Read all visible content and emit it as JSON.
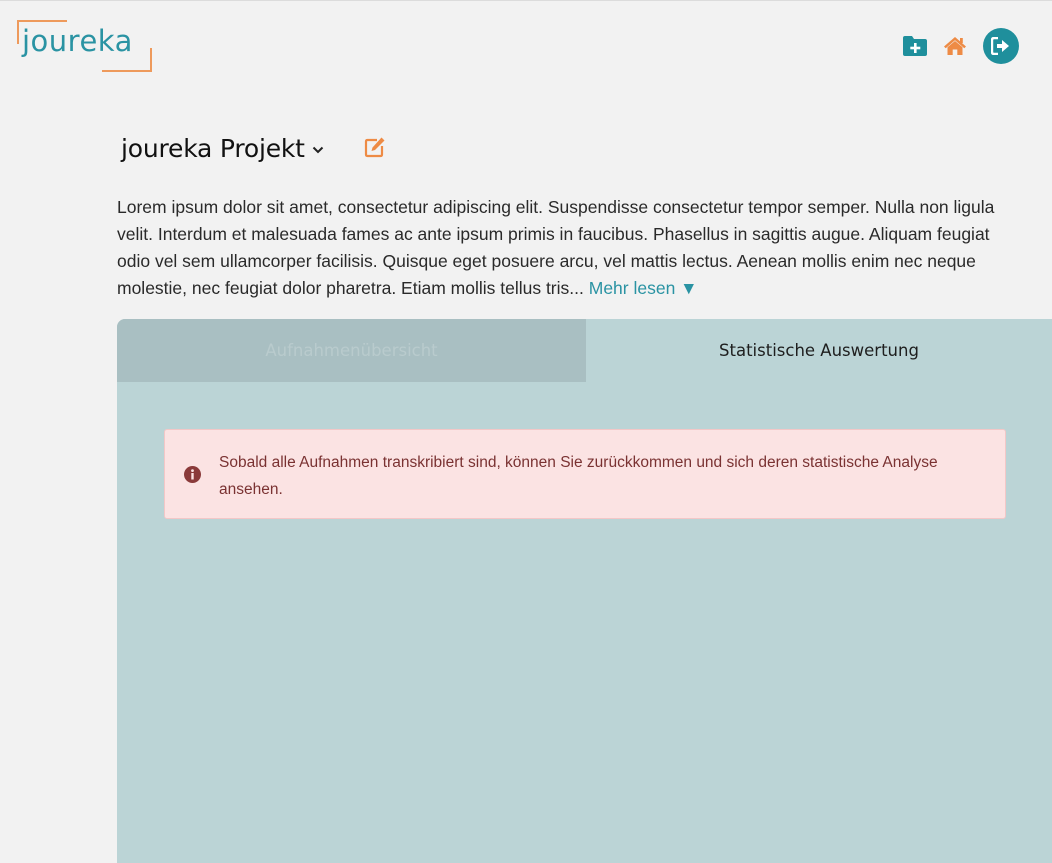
{
  "app": {
    "logo_text": "joureka",
    "brand_color": "#2a93a3",
    "accent_color": "#ee9a5c"
  },
  "header": {
    "icons": [
      "folder-plus-icon",
      "home-icon",
      "logout-icon"
    ]
  },
  "project": {
    "title": "joureka Projekt",
    "description": "Lorem ipsum dolor sit amet, consectetur adipiscing elit. Suspendisse consectetur tempor semper. Nulla non ligula velit. Interdum et malesuada fames ac ante ipsum primis in faucibus. Phasellus in sagittis augue. Aliquam feugiat odio vel sem ullamcorper facilisis. Quisque eget posuere arcu, vel mattis lectus. Aenean mollis enim nec neque molestie, nec feugiat dolor pharetra. Etiam mollis tellus tris...",
    "more_label": "Mehr lesen ▼"
  },
  "tabs": [
    {
      "label": "Aufnahmenübersicht",
      "active": false
    },
    {
      "label": "Statistische Auswertung",
      "active": true
    }
  ],
  "alert": {
    "type": "info",
    "text": "Sobald alle Aufnahmen transkribiert sind, können Sie zurückkommen und sich deren statistische Analyse ansehen."
  }
}
